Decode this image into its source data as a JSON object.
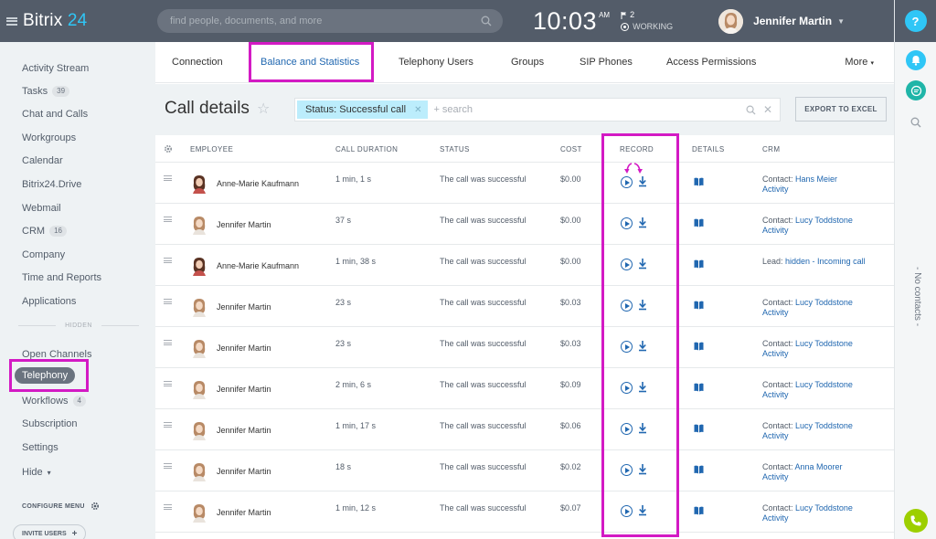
{
  "app": {
    "brand_name": "Bitrix",
    "brand_num": "24"
  },
  "topbar": {
    "search_placeholder": "find people, documents, and more",
    "time": "10:03",
    "ampm": "AM",
    "flag_count": "2",
    "work_status": "WORKING",
    "user_name": "Jennifer Martin"
  },
  "sidebar": {
    "items": [
      {
        "label": "Activity Stream"
      },
      {
        "label": "Tasks",
        "count": "39"
      },
      {
        "label": "Chat and Calls"
      },
      {
        "label": "Workgroups"
      },
      {
        "label": "Calendar"
      },
      {
        "label": "Bitrix24.Drive"
      },
      {
        "label": "Webmail"
      },
      {
        "label": "CRM",
        "count": "16"
      },
      {
        "label": "Company"
      },
      {
        "label": "Time and Reports"
      },
      {
        "label": "Applications"
      }
    ],
    "hidden_label": "HIDDEN",
    "hidden_items": [
      {
        "label": "Open Channels"
      },
      {
        "label": "Telephony"
      },
      {
        "label": "Workflows",
        "count": "4"
      },
      {
        "label": "Subscription"
      },
      {
        "label": "Settings"
      },
      {
        "label": "Hide"
      }
    ],
    "configure_menu": "CONFIGURE MENU",
    "invite_users": "INVITE USERS"
  },
  "tabs": {
    "items": [
      "Connection",
      "Balance and Statistics",
      "Telephony Users",
      "Groups",
      "SIP Phones",
      "Access Permissions"
    ],
    "more": "More"
  },
  "page": {
    "title": "Call details",
    "filter_chip": "Status: Successful call",
    "search_placeholder": "+ search",
    "export": "EXPORT TO EXCEL"
  },
  "table": {
    "headers": [
      "EMPLOYEE",
      "CALL DURATION",
      "STATUS",
      "COST",
      "RECORD",
      "DETAILS",
      "CRM"
    ],
    "rows": [
      {
        "employee": "Anne-Marie Kaufmann",
        "duration": "1 min, 1 s",
        "status": "The call was successful",
        "cost": "$0.00",
        "crm_prefix": "Contact: ",
        "crm_link": "Hans Meier",
        "crm_activity": "Activity"
      },
      {
        "employee": "Jennifer Martin",
        "duration": "37 s",
        "status": "The call was successful",
        "cost": "$0.00",
        "crm_prefix": "Contact: ",
        "crm_link": "Lucy Toddstone",
        "crm_activity": "Activity"
      },
      {
        "employee": "Anne-Marie Kaufmann",
        "duration": "1 min, 38 s",
        "status": "The call was successful",
        "cost": "$0.00",
        "crm_prefix": "Lead: ",
        "crm_link": "hidden - Incoming call",
        "crm_activity": ""
      },
      {
        "employee": "Jennifer Martin",
        "duration": "23 s",
        "status": "The call was successful",
        "cost": "$0.03",
        "crm_prefix": "Contact: ",
        "crm_link": "Lucy Toddstone",
        "crm_activity": "Activity"
      },
      {
        "employee": "Jennifer Martin",
        "duration": "23 s",
        "status": "The call was successful",
        "cost": "$0.03",
        "crm_prefix": "Contact: ",
        "crm_link": "Lucy Toddstone",
        "crm_activity": "Activity"
      },
      {
        "employee": "Jennifer Martin",
        "duration": "2 min, 6 s",
        "status": "The call was successful",
        "cost": "$0.09",
        "crm_prefix": "Contact: ",
        "crm_link": "Lucy Toddstone",
        "crm_activity": "Activity"
      },
      {
        "employee": "Jennifer Martin",
        "duration": "1 min, 17 s",
        "status": "The call was successful",
        "cost": "$0.06",
        "crm_prefix": "Contact: ",
        "crm_link": "Lucy Toddstone",
        "crm_activity": "Activity"
      },
      {
        "employee": "Jennifer Martin",
        "duration": "18 s",
        "status": "The call was successful",
        "cost": "$0.02",
        "crm_prefix": "Contact: ",
        "crm_link": "Anna Moorer",
        "crm_activity": "Activity"
      },
      {
        "employee": "Jennifer Martin",
        "duration": "1 min, 12 s",
        "status": "The call was successful",
        "cost": "$0.07",
        "crm_prefix": "Contact: ",
        "crm_link": "Lucy Toddstone",
        "crm_activity": "Activity"
      }
    ]
  },
  "rightrail": {
    "help": "?",
    "no_contacts": "- No contacts -"
  },
  "colors": {
    "header_bg": "#535c69",
    "accent": "#2fc6f6",
    "link": "#2067b0",
    "highlight": "#d31ac4"
  }
}
